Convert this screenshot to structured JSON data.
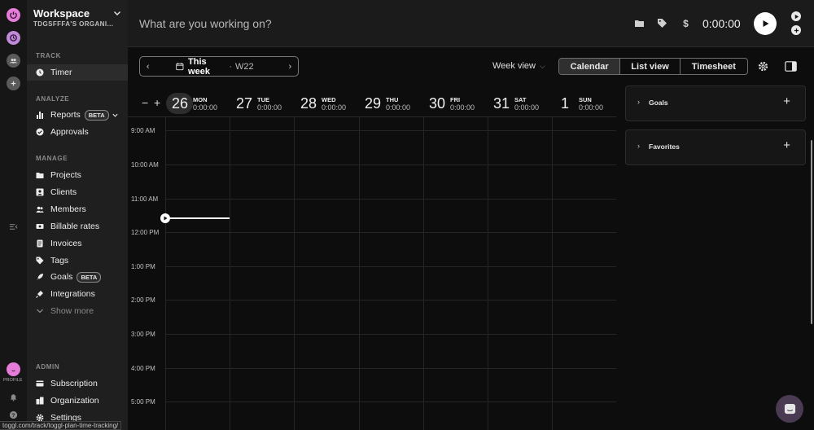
{
  "rail": {
    "profile_label": "PROFILE"
  },
  "workspace": {
    "title": "Workspace",
    "org": "TDGSFFFA'S ORGANI..."
  },
  "sections": {
    "track": "TRACK",
    "analyze": "ANALYZE",
    "manage": "MANAGE",
    "admin": "ADMIN"
  },
  "nav": {
    "timer": "Timer",
    "reports": "Reports",
    "reports_badge": "BETA",
    "approvals": "Approvals",
    "projects": "Projects",
    "clients": "Clients",
    "members": "Members",
    "billable_rates": "Billable rates",
    "invoices": "Invoices",
    "tags": "Tags",
    "goals": "Goals",
    "goals_badge": "BETA",
    "integrations": "Integrations",
    "show_more": "Show more",
    "subscription": "Subscription",
    "organization": "Organization",
    "settings": "Settings"
  },
  "topbar": {
    "description_placeholder": "What are you working on?",
    "timer": "0:00:00"
  },
  "toolbar": {
    "week_label": "This week",
    "week_number": "W22",
    "view_select": "Week view",
    "tabs": [
      "Calendar",
      "List view",
      "Timesheet"
    ],
    "active_tab": "Calendar"
  },
  "calendar": {
    "zoom_out": "−",
    "zoom_in": "+",
    "days": [
      {
        "num": "26",
        "name": "MON",
        "total": "0:00:00"
      },
      {
        "num": "27",
        "name": "TUE",
        "total": "0:00:00"
      },
      {
        "num": "28",
        "name": "WED",
        "total": "0:00:00"
      },
      {
        "num": "29",
        "name": "THU",
        "total": "0:00:00"
      },
      {
        "num": "30",
        "name": "FRI",
        "total": "0:00:00"
      },
      {
        "num": "31",
        "name": "SAT",
        "total": "0:00:00"
      },
      {
        "num": "1",
        "name": "SUN",
        "total": "0:00:00"
      }
    ],
    "hours": [
      "9:00 AM",
      "10:00 AM",
      "11:00 AM",
      "12:00 PM",
      "1:00 PM",
      "2:00 PM",
      "3:00 PM",
      "4:00 PM",
      "5:00 PM"
    ]
  },
  "panels": {
    "goals": "Goals",
    "favorites": "Favorites"
  },
  "statusbar": {
    "url": "toggl.com/track/toggl-plan-time-tracking/"
  },
  "colors": {
    "accent": "#e57cd8",
    "background": "#0d0d0d",
    "sidebar": "#1f1f1f"
  }
}
